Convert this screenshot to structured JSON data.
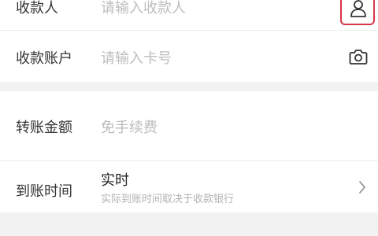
{
  "payee_section": {
    "payee_name": {
      "label": "收款人",
      "placeholder": "请输入收款人",
      "icon": "contact-person-icon"
    },
    "payee_account": {
      "label": "收款账户",
      "placeholder": "请输入卡号",
      "icon": "camera-icon"
    }
  },
  "transfer_section": {
    "amount": {
      "label": "转账金额",
      "placeholder": "免手续费"
    },
    "arrival_time": {
      "label": "到账时间",
      "value": "实时",
      "note": "实际到账时间取决于收款银行",
      "icon": "chevron-right-icon"
    }
  },
  "colors": {
    "highlight_border": "#d9364a",
    "placeholder_text": "#bdbdbd",
    "label_text": "#333333",
    "background": "#f2f2f2"
  }
}
